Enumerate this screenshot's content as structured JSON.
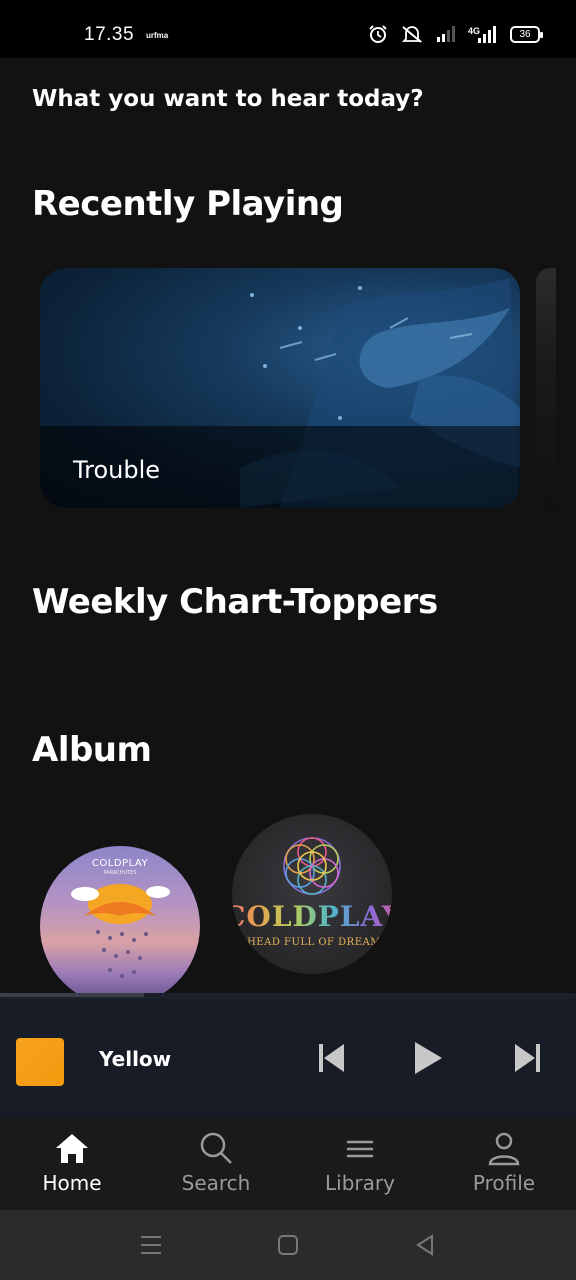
{
  "status_bar": {
    "time": "17.35",
    "carrier": "urfma",
    "network": "4G",
    "battery": "36"
  },
  "greeting": "What you want to hear today?",
  "sections": {
    "recently_playing": "Recently Playing",
    "weekly": "Weekly Chart-Toppers",
    "album": "Album"
  },
  "recently_playing": [
    {
      "title": "Trouble"
    }
  ],
  "albums": [
    {
      "band": "COLDPLAY",
      "subtitle": "PARACHUTES"
    },
    {
      "band": "COLDPLAY",
      "subtitle": "A HEAD FULL OF DREAMS"
    }
  ],
  "player": {
    "title": "Yellow",
    "progress": 0.25,
    "accent": "#F7A21D",
    "controls": [
      "skip-previous-icon",
      "play-icon",
      "skip-next-icon"
    ]
  },
  "nav": {
    "items": [
      {
        "label": "Home",
        "icon": "home-icon",
        "active": true
      },
      {
        "label": "Search",
        "icon": "search-icon",
        "active": false
      },
      {
        "label": "Library",
        "icon": "library-icon",
        "active": false
      },
      {
        "label": "Profile",
        "icon": "profile-icon",
        "active": false
      }
    ]
  },
  "colors": {
    "background": "#121212",
    "player_bg": "#171C26",
    "nav_bg": "#1A1A1A",
    "inactive": "#9A9A9A"
  }
}
